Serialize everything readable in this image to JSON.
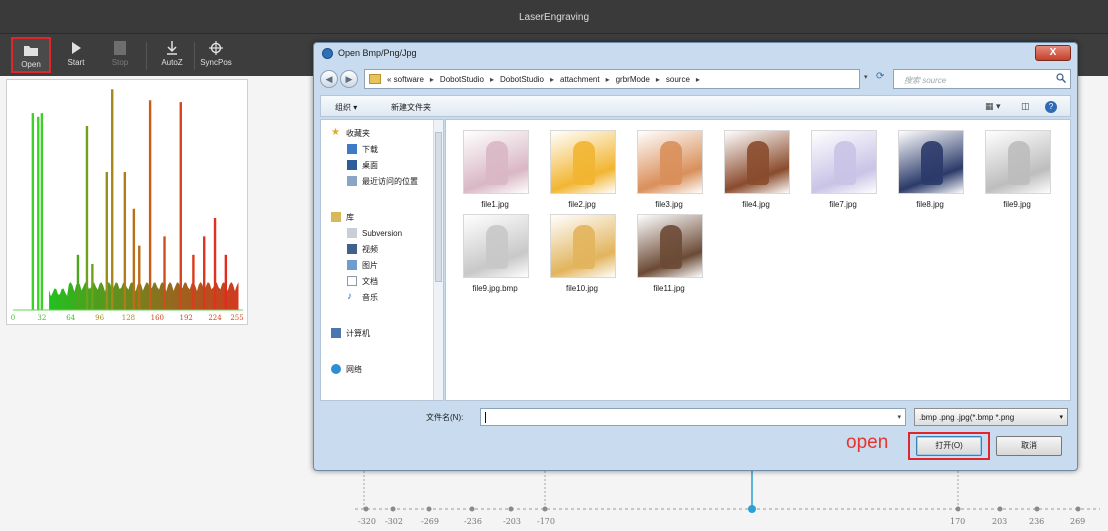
{
  "app": {
    "title": "LaserEngraving",
    "toolbar": [
      {
        "label": "Open",
        "icon": "folder-icon",
        "enabled": true
      },
      {
        "label": "Start",
        "icon": "play-icon",
        "enabled": true
      },
      {
        "label": "Stop",
        "icon": "stop-icon",
        "enabled": false
      },
      {
        "label": "AutoZ",
        "icon": "autoz-icon",
        "enabled": true
      },
      {
        "label": "SyncPos",
        "icon": "crosshair-icon",
        "enabled": true
      }
    ]
  },
  "histogram": {
    "x_ticks": [
      "0",
      "32",
      "64",
      "96",
      "128",
      "160",
      "192",
      "224",
      "255"
    ],
    "colors": [
      "#22c01e",
      "#d23a1e"
    ]
  },
  "axis_ticks": [
    "-320",
    "-302",
    "-269",
    "-236",
    "-203",
    "-170",
    "170",
    "203",
    "236",
    "269"
  ],
  "dialog": {
    "title": "Open Bmp/Png/Jpg",
    "close_label": "X",
    "address_prefix": "«",
    "breadcrumbs": [
      "software",
      "DobotStudio",
      "DobotStudio",
      "attachment",
      "grbrMode",
      "source"
    ],
    "search_placeholder": "搜索 source",
    "toolbar": {
      "organize": "组织 ▾",
      "new_folder": "新建文件夹",
      "view": "▦ ▾",
      "pane": "◫",
      "help": "?"
    },
    "nav": {
      "favorites": "收藏夹",
      "favorites_items": [
        "下载",
        "桌面",
        "最近访问的位置"
      ],
      "libraries": "库",
      "libraries_items": [
        "Subversion",
        "视频",
        "图片",
        "文档",
        "音乐"
      ],
      "computer": "计算机",
      "network": "网络"
    },
    "files": [
      {
        "name": "file1.jpg",
        "thumb": "#d9b7c4"
      },
      {
        "name": "file2.jpg",
        "thumb": "#f2b531"
      },
      {
        "name": "file3.jpg",
        "thumb": "#d98f5a"
      },
      {
        "name": "file4.jpg",
        "thumb": "#8a4b2d"
      },
      {
        "name": "file7.jpg",
        "thumb": "#c9c3e6"
      },
      {
        "name": "file8.jpg",
        "thumb": "#2b3a6a"
      },
      {
        "name": "file9.jpg",
        "thumb": "#bdbdbd"
      },
      {
        "name": "file9.jpg.bmp",
        "thumb": "#c8c8c8"
      },
      {
        "name": "file10.jpg",
        "thumb": "#e2b45c"
      },
      {
        "name": "file11.jpg",
        "thumb": "#6b4a35"
      }
    ],
    "filename_label": "文件名(N):",
    "filename_value": "",
    "filetype": ".bmp .png .jpg(*.bmp *.png",
    "open_annotation": "open",
    "open_button": "打开(O)",
    "cancel_button": "取消"
  }
}
